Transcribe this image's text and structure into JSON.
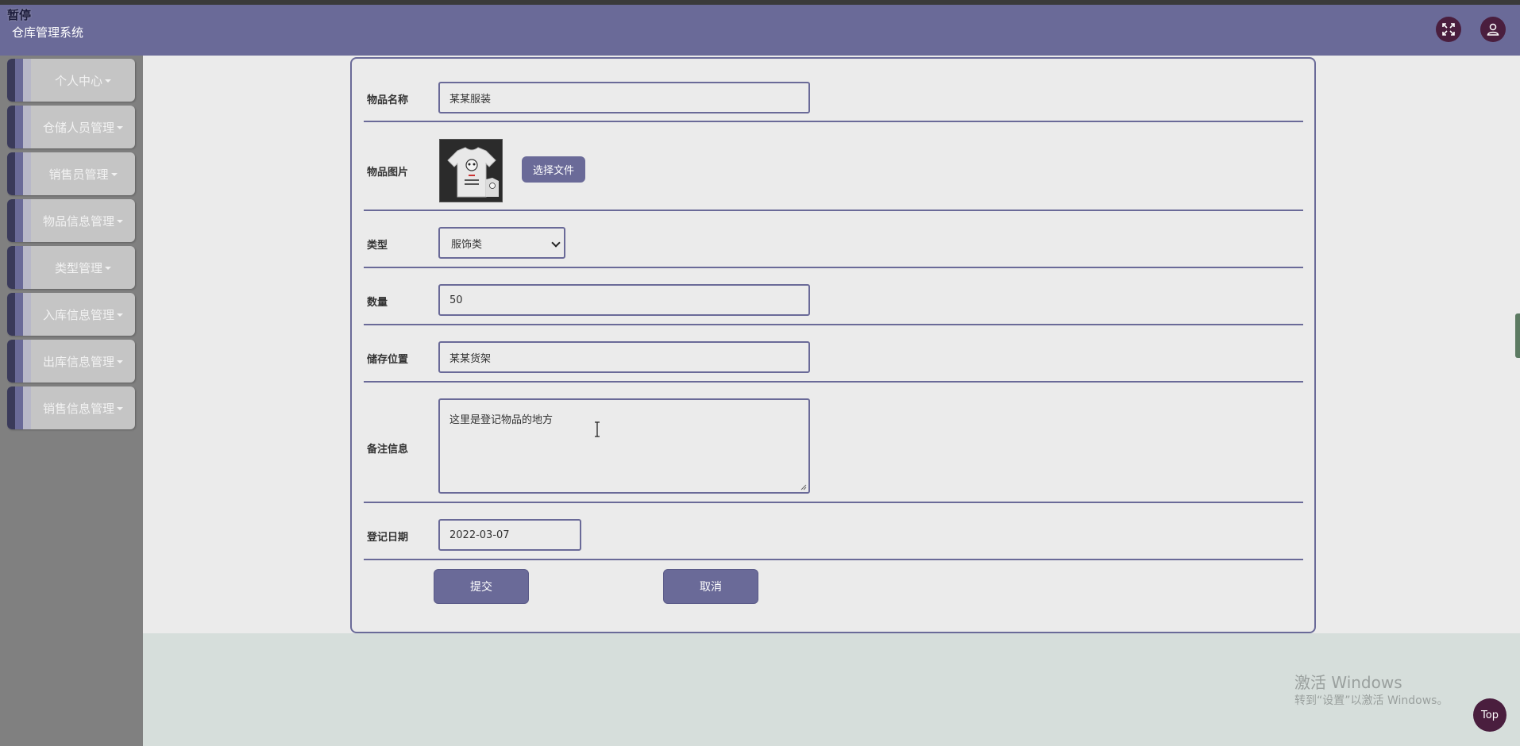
{
  "header": {
    "paused_badge": "暂停",
    "app_title": "仓库管理系统",
    "fullscreen_icon": "expand-icon",
    "user_icon": "user-icon"
  },
  "sidebar": {
    "items": [
      {
        "label": "个人中心"
      },
      {
        "label": "仓储人员管理"
      },
      {
        "label": "销售员管理"
      },
      {
        "label": "物品信息管理"
      },
      {
        "label": "类型管理"
      },
      {
        "label": "入库信息管理"
      },
      {
        "label": "出库信息管理"
      },
      {
        "label": "销售信息管理"
      }
    ]
  },
  "form": {
    "item_name": {
      "label": "物品名称",
      "value": "某某服装"
    },
    "item_image": {
      "label": "物品图片",
      "button": "选择文件"
    },
    "type": {
      "label": "类型",
      "selected": "服饰类"
    },
    "quantity": {
      "label": "数量",
      "value": "50"
    },
    "location": {
      "label": "储存位置",
      "value": "某某货架"
    },
    "remarks": {
      "label": "备注信息",
      "value": "这里是登记物品的地方"
    },
    "date": {
      "label": "登记日期",
      "value": "2022-03-07"
    },
    "submit_label": "提交",
    "cancel_label": "取消"
  },
  "overlay": {
    "windows_title": "激活 Windows",
    "windows_sub": "转到“设置”以激活 Windows。",
    "top_button": "Top"
  },
  "colors": {
    "accent": "#6a6a98",
    "header_button": "#4a1e3e",
    "sidebar_bg": "#808080"
  }
}
